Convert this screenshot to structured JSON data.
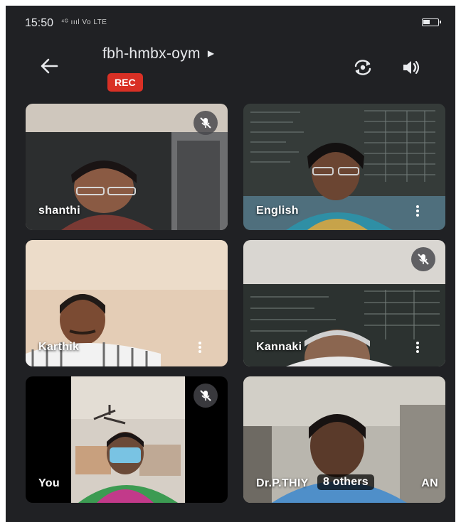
{
  "status_bar": {
    "time": "15:50",
    "signal": "⁴ᴳ ıııl Vo LTE"
  },
  "meeting": {
    "code": "fbh-hmbx-oym",
    "rec_label": "REC"
  },
  "tiles": [
    {
      "name": "shanthi",
      "muted": true
    },
    {
      "name": "English",
      "muted": false
    },
    {
      "name": "Karthik",
      "muted": false
    },
    {
      "name": "Kannaki",
      "muted": true
    },
    {
      "name": "You",
      "muted": true
    },
    {
      "name": "Dr.P.THIY",
      "others_label": "8 others",
      "trailing": "AN"
    }
  ],
  "icons": {
    "back": "arrow-left-icon",
    "flip_camera": "flip-camera-icon",
    "speaker": "speaker-icon",
    "mic_off": "mic-off-icon",
    "more": "more-vertical-icon"
  },
  "colors": {
    "background": "#202124",
    "rec": "#d93025",
    "text": "#e8eaed"
  }
}
